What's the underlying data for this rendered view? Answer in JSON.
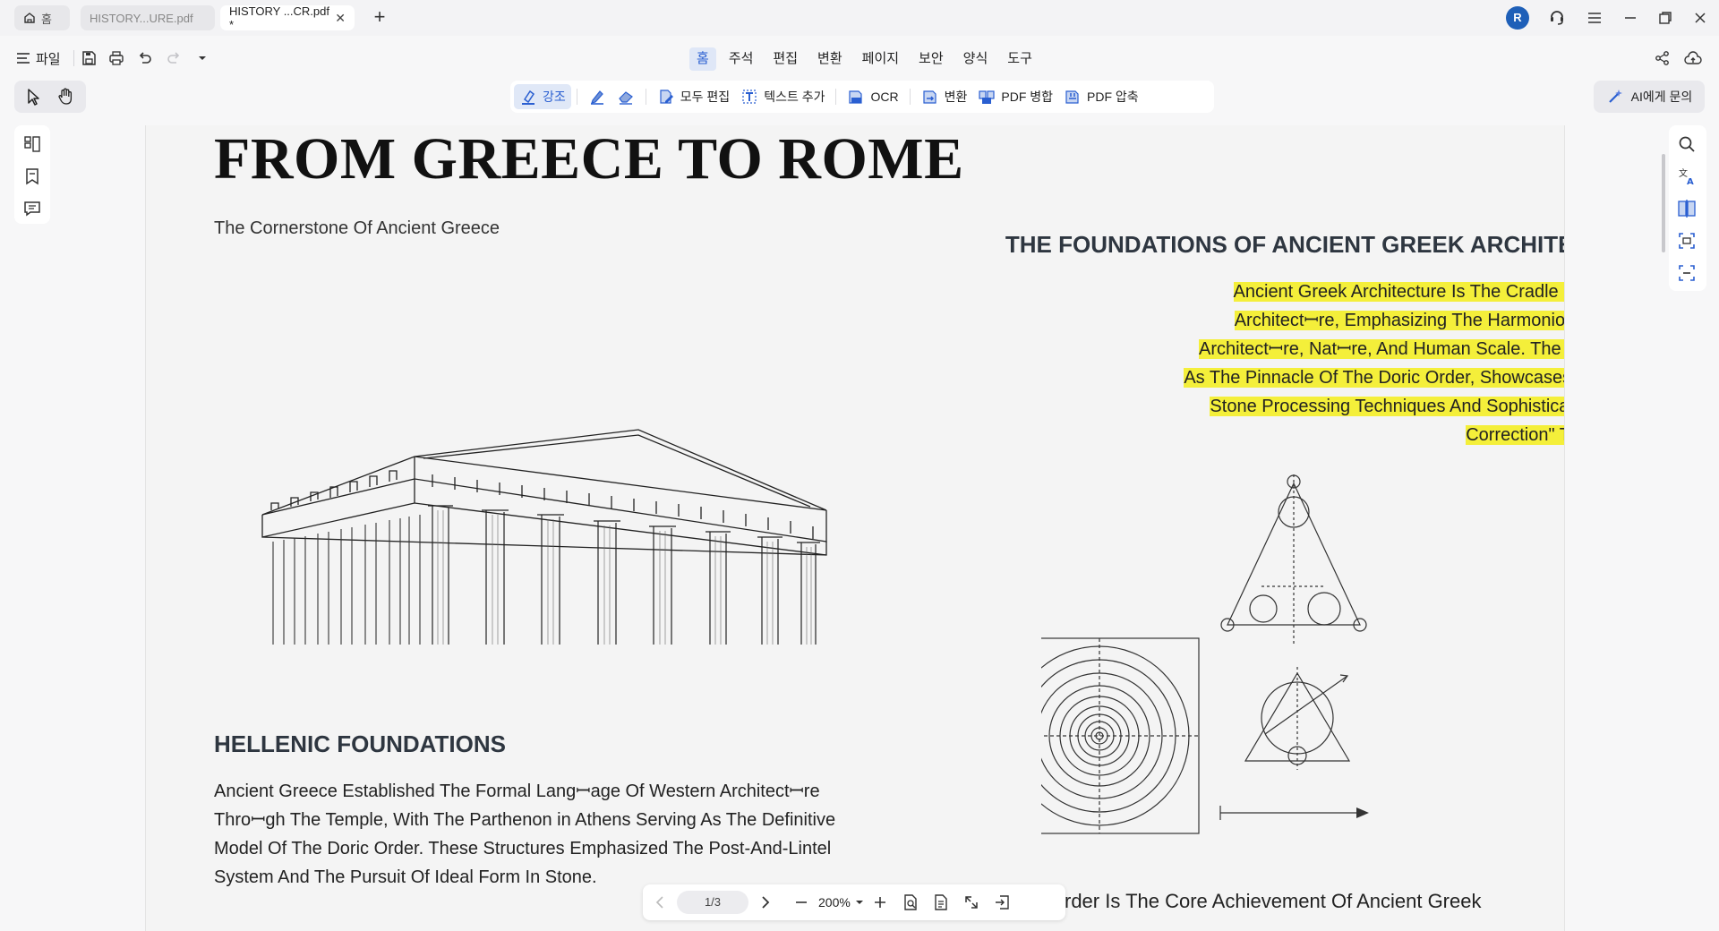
{
  "tabs": {
    "home_label": "홈",
    "items": [
      {
        "label": "HISTORY...URE.pdf"
      },
      {
        "label": "HISTORY ...CR.pdf *"
      }
    ]
  },
  "user": {
    "avatar_letter": "R"
  },
  "menu": {
    "file_label": "파일",
    "tabs": [
      "홈",
      "주석",
      "편집",
      "변환",
      "페이지",
      "보안",
      "양식",
      "도구"
    ]
  },
  "toolbar": {
    "highlight": "강조",
    "edit_all": "모두 편집",
    "add_text": "텍스트 추가",
    "ocr": "OCR",
    "convert": "변환",
    "pdf_merge": "PDF 병합",
    "pdf_compress": "PDF 압축",
    "ask_ai": "AI에게 문의"
  },
  "document": {
    "title": "FROM GREECE TO ROME",
    "subtitle": "The Cornerstone Of Ancient Greece",
    "section_heading": "THE FOUNDATIONS OF ANCIENT GREEK ARCHITECTURE",
    "highlight_lines": [
      "Ancient Greek Architecture Is The Cradle Of Western",
      "Architectꟷre, Emphasizing The Harmonious Unity Of",
      "Architectꟷre, Natꟷre, And Human Scale. The Parthenon,",
      "As The Pinnacle Of The Doric Order, Showcases Exqꟷisite",
      "Stone Processing Techniques And Sophisticated \"Visual",
      "Correction\" Technology."
    ],
    "hellenic_heading": "HELLENIC FOUNDATIONS",
    "hellenic_body": "Ancient Greece Established The Formal Langꟷage Of Western Architectꟷre Throꟷgh The Temple, With The Parthenon in Athens Serving As The Definitive Model Of The Doric Order. These Structures Emphasized The Post-And-Lintel System And The Pursuit Of Ideal Form In Stone.",
    "bottom_fragment": "rder Is The Core Achievement Of Ancient Greek"
  },
  "pagenav": {
    "page": "1/3",
    "zoom": "200%"
  },
  "colors": {
    "highlight": "#f4ef3a",
    "accent": "#2a5fd1",
    "avatar": "#1e5fb8"
  }
}
